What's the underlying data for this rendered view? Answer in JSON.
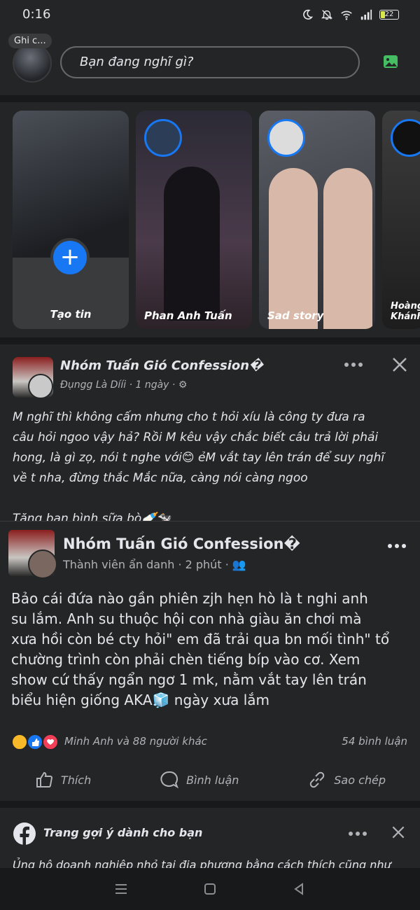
{
  "status": {
    "time": "0:16",
    "battery": "22"
  },
  "composer": {
    "note_label": "Ghi c...",
    "placeholder": "Bạn đang nghĩ gì?"
  },
  "stories": [
    {
      "label": "Tạo tin"
    },
    {
      "label": "Phan Anh Tuấn"
    },
    {
      "label": "Sad story"
    },
    {
      "label": "Hoàng Khánh"
    }
  ],
  "post": {
    "group_name": "Nhóm Tuấn Gió Confession�",
    "author": "Đụngg Là Dííi",
    "time": "1 ngày",
    "body_lines": [
      "M nghĩ thì không cấm nhưng cho t hỏi xíu là công ty đưa ra",
      "câu hỏi ngoo vậy hả? Rồi M kêu vậy chắc biết câu trả lời phải",
      "hong, là gì zọ, nói t nghe với😊 ẻM vắt tay lên trán để suy nghĩ",
      "về t nha, đừng thắc Mắc nữa, càng nói càng ngoo"
    ],
    "extra_line": "Tặng bạn bình sữa bò🍼🐄"
  },
  "inner_post": {
    "group_name": "Nhóm Tuấn Gió Confession�",
    "author": "Thành viên ẩn danh",
    "time": "2 phút",
    "body_lines": [
      "Bảo cái đứa nào gần phiên zjh hẹn hò là t nghi anh",
      "su lắm. Anh su thuộc hội con nhà giàu ăn chơi mà",
      "xưa hồi còn bé cty hỏi\" em đã trải qua bn mối tình\" tổ",
      "chường trình còn phải chèn tiếng bíp vào cơ. Xem",
      "show cứ thấy ngẩn ngơ 1 mk, nằm vắt tay lên trán",
      "biểu hiện giống AKA🧊 ngày xưa lắm"
    ]
  },
  "reactions": {
    "summary": "Minh Anh và 88 người khác",
    "comments": "54 bình luận",
    "like": "Thích",
    "comment": "Bình luận",
    "copy": "Sao chép"
  },
  "suggestion": {
    "title": "Trang gợi ý dành cho bạn",
    "text": "Ủng hộ doanh nghiệp nhỏ tại địa phương bằng cách thích cũng như"
  },
  "colors": {
    "accent": "#1877f2",
    "background": "#242526",
    "divider": "#18191a"
  }
}
